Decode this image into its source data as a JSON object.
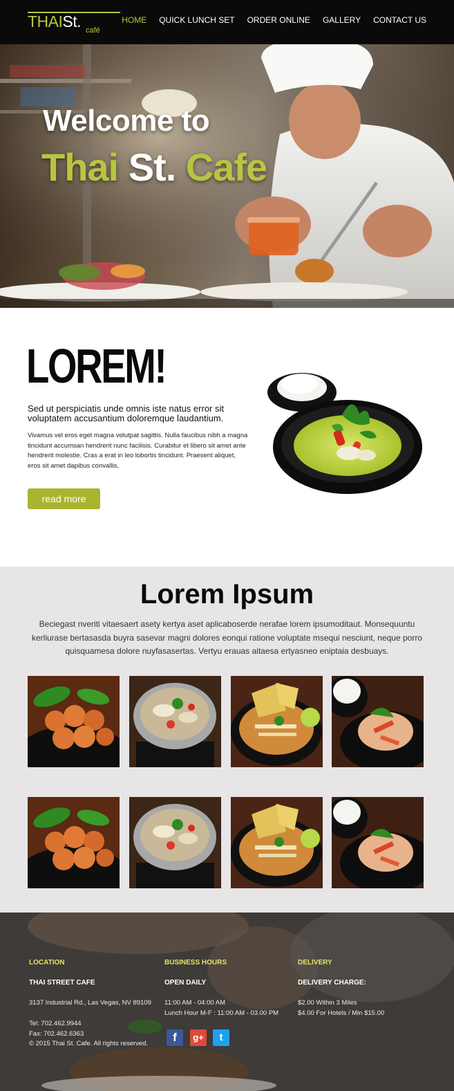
{
  "nav": {
    "logo_thai": "THAI",
    "logo_st": "St.",
    "logo_cafe": "café",
    "items": [
      {
        "label": "HOME",
        "active": true
      },
      {
        "label": "QUICK LUNCH SET",
        "active": false
      },
      {
        "label": "ORDER ONLINE",
        "active": false
      },
      {
        "label": "GALLERY",
        "active": false
      },
      {
        "label": "CONTACT US",
        "active": false
      }
    ]
  },
  "hero": {
    "line1": "Welcome to",
    "word_thai": "Thai",
    "word_st": "St.",
    "word_cafe": "Cafe"
  },
  "intro": {
    "heading": "LOREM!",
    "subheading": "Sed ut perspiciatis unde omnis iste natus error sit voluptatem accusantium doloremque laudantium.",
    "body": "Vivamus vel eros eget magna volutpat sagittis. Nulla faucibus nibh a magna tincidunt accumsan hendrerit nunc facilisis. Curabitur et libero sit amet ante hendrerit molestie. Cras a erat in leo lobortis tincidunt. Praesent aliquet, eros sit amet dapibus convallis,",
    "button_label": "read more"
  },
  "gallery": {
    "title": "Lorem Ipsum",
    "text": "Beciegast nveriti vitaesaert asety kertya aset aplicaboserde nerafae lorem ipsumoditaut. Monsequuntu kerliurase bertasasda buyra sasevar magni dolores eonqui ratione voluptate msequi nesciunt, neque porro quisquamesa dolore nuyfasasertas. Vertyu erauas aitaesa ertyasneo eniptaia desbuays."
  },
  "footer": {
    "location": {
      "heading": "LOCATION",
      "name": "THAI STREET CAFE",
      "address": "3137 Industrial Rd., Las Vegas, NV 89109",
      "tel": "Tel: 702.462.9944",
      "fax": "Fax: 702.462.6363",
      "copyright": "© 2015 Thai St. Cafe. All rights reserved."
    },
    "hours": {
      "heading": "BUSINESS HOURS",
      "sub": "OPEN DAILY",
      "line1": "11:00 AM - 04:00 AM",
      "line2": "Lunch Hour M-F : 11:00 AM - 03.00 PM"
    },
    "delivery": {
      "heading": "DELIVERY",
      "sub": "DELIVERY CHARGE:",
      "line1": "$2.00 Within 3 Miles",
      "line2": "$4.00 For Hotels / Min $15.00"
    },
    "social": [
      {
        "icon": "facebook-icon",
        "glyph": "f",
        "color": "#3b5998"
      },
      {
        "icon": "google-plus-icon",
        "glyph": "g+",
        "color": "#dd4b39"
      },
      {
        "icon": "twitter-icon",
        "glyph": "t",
        "color": "#1da1f2"
      }
    ]
  },
  "colors": {
    "accent": "#b9c540",
    "button": "#a9b52f",
    "footer_heading": "#e5e36a",
    "gallery_bg": "#e7e5e6"
  }
}
